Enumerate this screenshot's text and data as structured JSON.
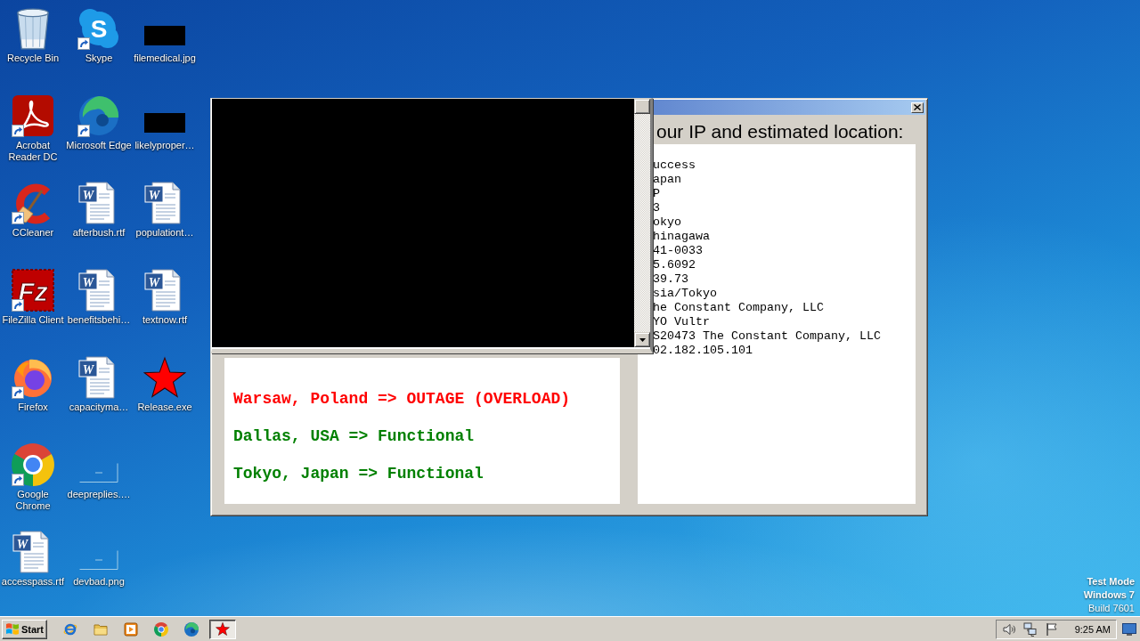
{
  "desktop_icons": [
    {
      "label": "Recycle Bin",
      "kind": "bin",
      "shortcut": false
    },
    {
      "label": "Acrobat Reader DC",
      "kind": "acrobat",
      "shortcut": true
    },
    {
      "label": "CCleaner",
      "kind": "ccleaner",
      "shortcut": true
    },
    {
      "label": "FileZilla Client",
      "kind": "filezilla",
      "shortcut": true,
      "logo_letter": "Fz"
    },
    {
      "label": "Firefox",
      "kind": "firefox",
      "shortcut": true
    },
    {
      "label": "Google Chrome",
      "kind": "chrome",
      "shortcut": true
    },
    {
      "label": "accesspass.rtf",
      "kind": "document",
      "shortcut": false,
      "logo_letter": "W"
    },
    {
      "label": "Skype",
      "kind": "skype",
      "shortcut": true,
      "logo_letter": "S"
    },
    {
      "label": "Microsoft Edge",
      "kind": "edge",
      "shortcut": true
    },
    {
      "label": "afterbush.rtf",
      "kind": "document",
      "shortcut": false,
      "logo_letter": "W"
    },
    {
      "label": "benefitsbehi…",
      "kind": "document",
      "shortcut": false,
      "logo_letter": "W"
    },
    {
      "label": "capacityma…",
      "kind": "document",
      "shortcut": false,
      "logo_letter": "W"
    },
    {
      "label": "deepreplies.…",
      "kind": "blankimage",
      "shortcut": false
    },
    {
      "label": "devbad.png",
      "kind": "blankimage",
      "shortcut": false
    },
    {
      "label": "filemedical.jpg",
      "kind": "darkimage",
      "shortcut": false
    },
    {
      "label": "likelyproper…",
      "kind": "darkimage",
      "shortcut": false
    },
    {
      "label": "populationt…",
      "kind": "document",
      "shortcut": false,
      "logo_letter": "W"
    },
    {
      "label": "textnow.rtf",
      "kind": "document",
      "shortcut": false,
      "logo_letter": "W"
    },
    {
      "label": "Release.exe",
      "kind": "star",
      "shortcut": false
    }
  ],
  "main_window": {
    "heading": "our IP and estimated location:",
    "status_lines": [
      {
        "text": "Warsaw, Poland => OUTAGE (OVERLOAD)",
        "color": "#ff0000"
      },
      {
        "text": "Dallas, USA => Functional",
        "color": "#008000"
      },
      {
        "text": "Tokyo, Japan => Functional",
        "color": "#008000"
      }
    ],
    "location_lines": [
      "uccess",
      "apan",
      "P",
      "3",
      "okyo",
      "hinagawa",
      "41-0033",
      "5.6092",
      "39.73",
      "sia/Tokyo",
      "he Constant Company, LLC",
      "YO Vultr",
      "S20473 The Constant Company, LLC",
      "02.182.105.101"
    ]
  },
  "system_notice": {
    "mode": "Test Mode",
    "os": "Windows 7",
    "build": "Build 7601"
  },
  "taskbar": {
    "start_label": "Start",
    "quick_launch": [
      {
        "kind": "ie"
      },
      {
        "kind": "folder"
      },
      {
        "kind": "media"
      },
      {
        "kind": "chrome"
      },
      {
        "kind": "edge"
      }
    ],
    "tasks": [
      {
        "kind": "star",
        "selected": true
      }
    ],
    "tray_icons": [
      {
        "kind": "speaker"
      },
      {
        "kind": "network"
      },
      {
        "kind": "flag"
      }
    ],
    "clock": "9:25 AM"
  }
}
